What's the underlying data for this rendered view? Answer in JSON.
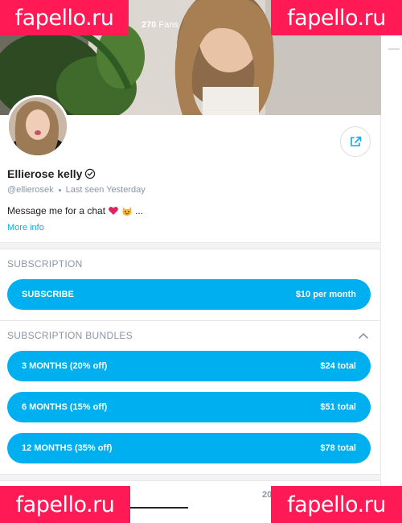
{
  "cover": {
    "fans_count": "270",
    "fans_label": "Fans"
  },
  "profile": {
    "name": "Ellierose kelly",
    "handle": "@ellierosek",
    "last_seen": "Last seen Yesterday",
    "bio": "Message me for a chat",
    "bio_suffix": "...",
    "more_info": "More info"
  },
  "subscription": {
    "title": "SUBSCRIPTION",
    "button_label": "SUBSCRIBE",
    "button_price": "$10 per month"
  },
  "bundles": {
    "title": "SUBSCRIPTION BUNDLES",
    "items": [
      {
        "label": "3 MONTHS (20% off)",
        "price": "$24 total"
      },
      {
        "label": "6 MONTHS (15% off)",
        "price": "$51 total"
      },
      {
        "label": "12 MONTHS (35% off)",
        "price": "$78 total"
      }
    ]
  },
  "tabs": {
    "media_count_partial": "20"
  },
  "watermark": {
    "text": "fapello.ru"
  },
  "colors": {
    "accent": "#00aff0",
    "watermark": "#ff1a55"
  }
}
